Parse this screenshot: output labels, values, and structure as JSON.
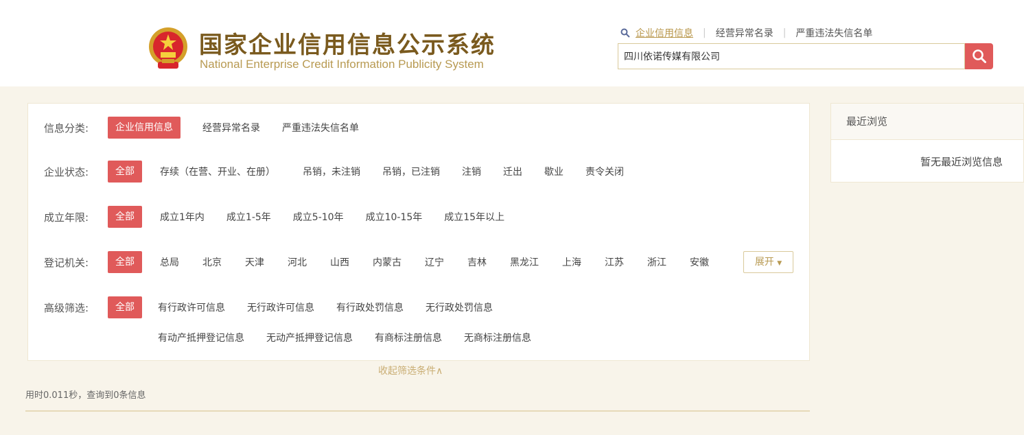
{
  "header": {
    "title_cn": "国家企业信用信息公示系统",
    "title_en": "National Enterprise Credit Information Publicity System",
    "tabs": [
      {
        "label": "企业信用信息",
        "active": true
      },
      {
        "label": "经营异常名录",
        "active": false
      },
      {
        "label": "严重违法失信名单",
        "active": false
      }
    ],
    "search_value": "四川依诺传媒有限公司"
  },
  "filters": {
    "category": {
      "label": "信息分类:",
      "selected": "企业信用信息",
      "options": [
        "经营异常名录",
        "严重违法失信名单"
      ]
    },
    "status": {
      "label": "企业状态:",
      "selected": "全部",
      "options": [
        "存续（在营、开业、在册）",
        "吊销，未注销",
        "吊销，已注销",
        "注销",
        "迁出",
        "歇业",
        "责令关闭"
      ]
    },
    "years": {
      "label": "成立年限:",
      "selected": "全部",
      "options": [
        "成立1年内",
        "成立1-5年",
        "成立5-10年",
        "成立10-15年",
        "成立15年以上"
      ]
    },
    "authority": {
      "label": "登记机关:",
      "selected": "全部",
      "options": [
        "总局",
        "北京",
        "天津",
        "河北",
        "山西",
        "内蒙古",
        "辽宁",
        "吉林",
        "黑龙江",
        "上海",
        "江苏",
        "浙江",
        "安徽"
      ],
      "expand_label": "展开"
    },
    "advanced": {
      "label": "高级筛选:",
      "selected": "全部",
      "options_row1": [
        "有行政许可信息",
        "无行政许可信息",
        "有行政处罚信息",
        "无行政处罚信息"
      ],
      "options_row2": [
        "有动产抵押登记信息",
        "无动产抵押登记信息",
        "有商标注册信息",
        "无商标注册信息"
      ]
    },
    "collapse_label": "收起筛选条件∧"
  },
  "result_info": "用时0.011秒，查询到0条信息",
  "recent": {
    "title": "最近浏览",
    "empty": "暂无最近浏览信息"
  },
  "colors": {
    "accent_red": "#e05a5a",
    "gold": "#b89a52",
    "title_brown": "#7a5a1e"
  }
}
